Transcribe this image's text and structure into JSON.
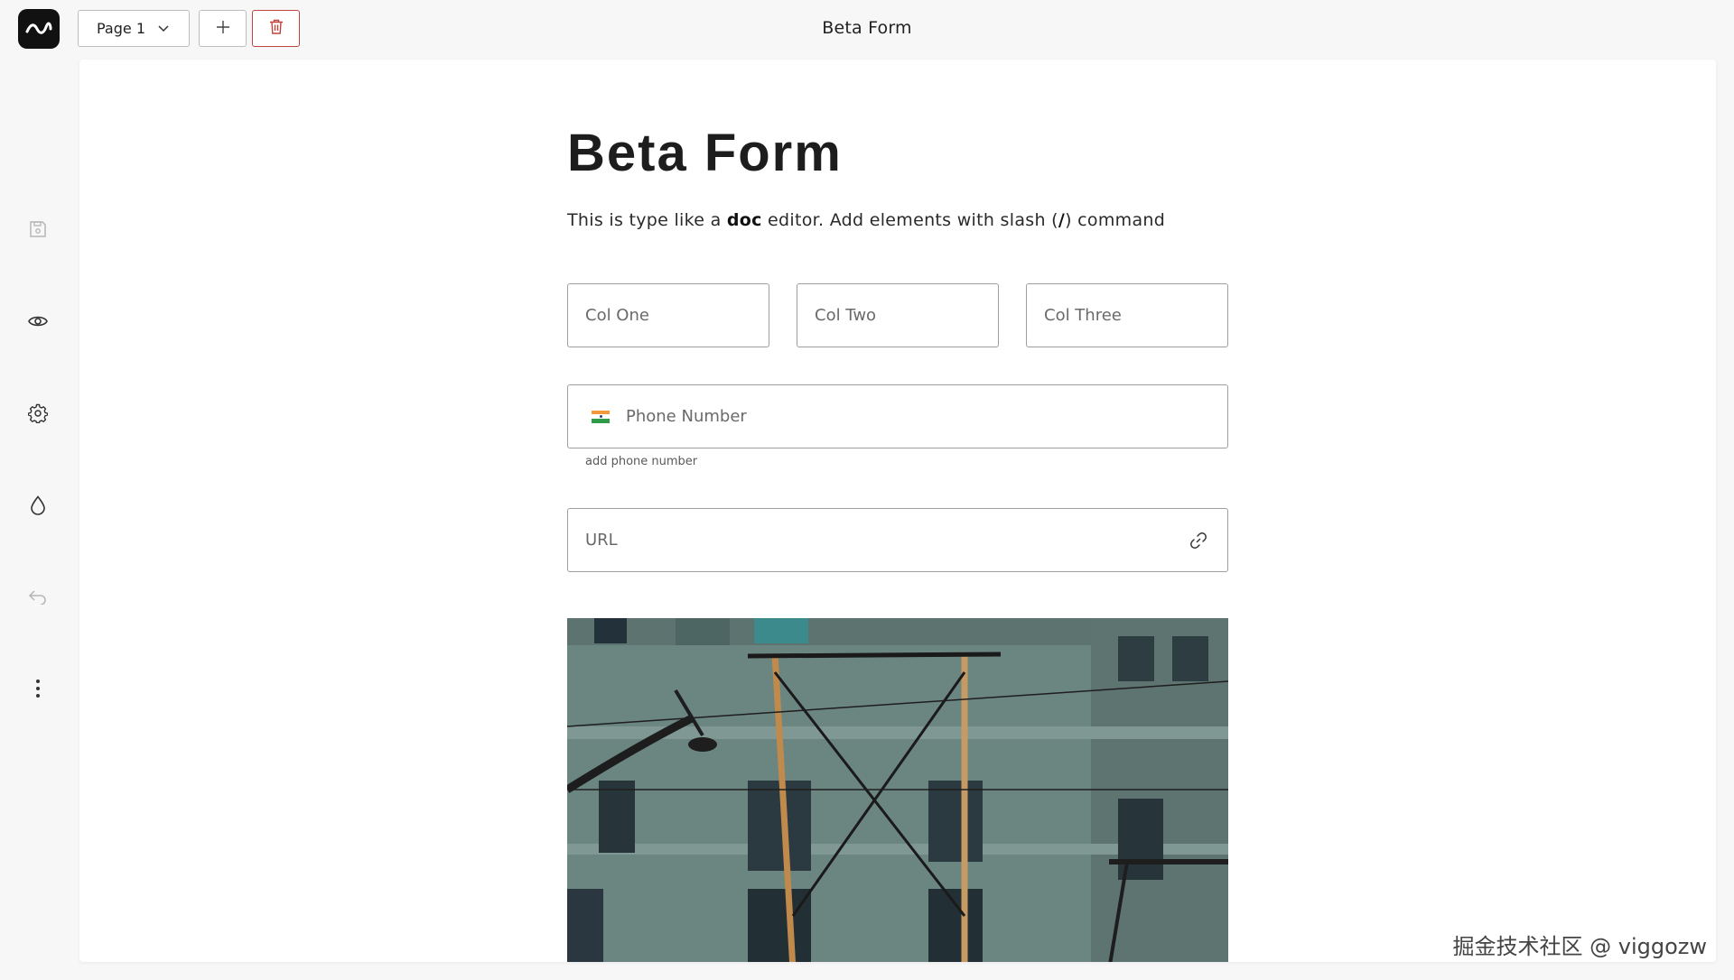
{
  "header": {
    "app_title": "Beta Form",
    "page_select": "Page 1",
    "icons": {
      "logo": "wave-logo-icon",
      "add": "plus-icon",
      "delete": "trash-icon"
    },
    "colors": {
      "delete": "#c0443f"
    }
  },
  "sidebar": {
    "items": [
      {
        "name": "save",
        "icon": "save-icon"
      },
      {
        "name": "preview",
        "icon": "eye-icon"
      },
      {
        "name": "settings",
        "icon": "gear-icon"
      },
      {
        "name": "theme",
        "icon": "droplet-icon"
      },
      {
        "name": "undo",
        "icon": "undo-icon"
      },
      {
        "name": "more",
        "icon": "more-vertical-icon"
      }
    ]
  },
  "form": {
    "title": "Beta Form",
    "description": {
      "before": "This is type like a ",
      "bold": "doc",
      "after": " editor. Add elements with slash (",
      "slash": "/",
      "end": ") command"
    },
    "columns": [
      {
        "placeholder": "Col One"
      },
      {
        "placeholder": "Col Two"
      },
      {
        "placeholder": "Col Three"
      }
    ],
    "phone": {
      "placeholder": "Phone Number",
      "helper": "add phone number",
      "flag": "india-flag-icon"
    },
    "url": {
      "placeholder": "URL",
      "icon": "link-icon"
    },
    "image": {
      "alt": "Street scene with tram overhead wires in front of a building"
    }
  },
  "watermark": "掘金技术社区 @ viggozw"
}
